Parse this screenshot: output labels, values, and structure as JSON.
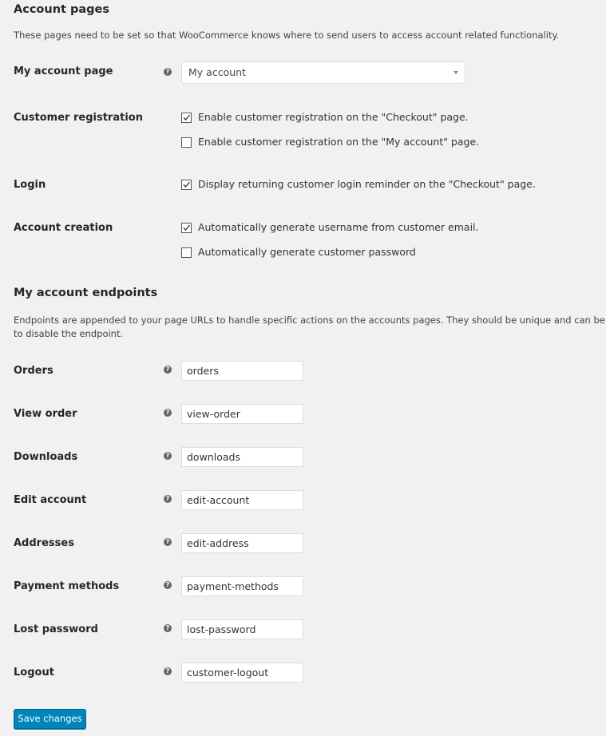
{
  "account_pages": {
    "title": "Account pages",
    "description": "These pages need to be set so that WooCommerce knows where to send users to access account related functionality.",
    "my_account_page": {
      "label": "My account page",
      "value": "My account"
    },
    "customer_registration": {
      "label": "Customer registration",
      "options": [
        {
          "text": "Enable customer registration on the \"Checkout\" page.",
          "checked": true
        },
        {
          "text": "Enable customer registration on the \"My account\" page.",
          "checked": false
        }
      ]
    },
    "login": {
      "label": "Login",
      "options": [
        {
          "text": "Display returning customer login reminder on the \"Checkout\" page.",
          "checked": true
        }
      ]
    },
    "account_creation": {
      "label": "Account creation",
      "options": [
        {
          "text": "Automatically generate username from customer email.",
          "checked": true
        },
        {
          "text": "Automatically generate customer password",
          "checked": false
        }
      ]
    }
  },
  "endpoints": {
    "title": "My account endpoints",
    "description_line1": "Endpoints are appended to your page URLs to handle specific actions on the accounts pages. They should be unique and can be left blank",
    "description_line2": "to disable the endpoint.",
    "fields": [
      {
        "label": "Orders",
        "value": "orders"
      },
      {
        "label": "View order",
        "value": "view-order"
      },
      {
        "label": "Downloads",
        "value": "downloads"
      },
      {
        "label": "Edit account",
        "value": "edit-account"
      },
      {
        "label": "Addresses",
        "value": "edit-address"
      },
      {
        "label": "Payment methods",
        "value": "payment-methods"
      },
      {
        "label": "Lost password",
        "value": "lost-password"
      },
      {
        "label": "Logout",
        "value": "customer-logout"
      }
    ]
  },
  "icons": {
    "help": "?",
    "checkmark": "check-icon",
    "dropdown": "chevron-down-icon"
  },
  "save_button": {
    "label": "Save changes"
  },
  "colors": {
    "primary": "#0085ba",
    "background": "#f1f1f1"
  }
}
